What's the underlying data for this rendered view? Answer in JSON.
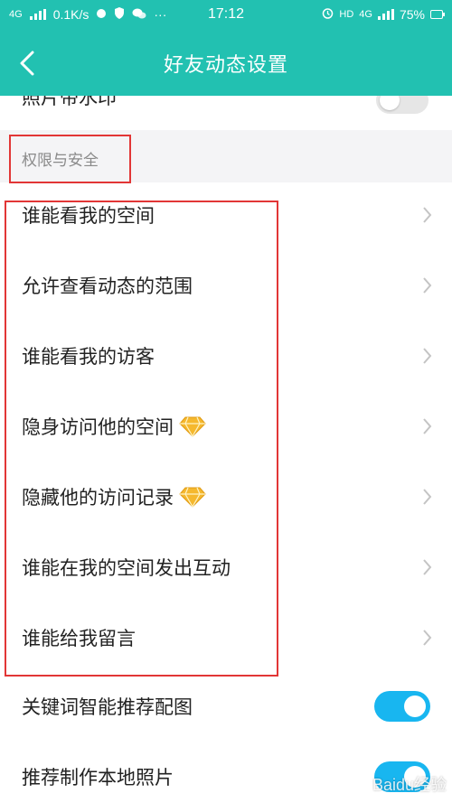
{
  "status_bar": {
    "network": "4G",
    "speed": "0.1K/s",
    "time": "17:12",
    "hd": "HD",
    "network_right": "4G",
    "battery": "75%"
  },
  "header": {
    "title": "好友动态设置",
    "back_icon": "chevron-left-icon"
  },
  "partial_row": {
    "label": "照片带水印",
    "toggle_on": false
  },
  "section": {
    "label": "权限与安全"
  },
  "items": [
    {
      "label": "谁能看我的空间",
      "vip": false
    },
    {
      "label": "允许查看动态的范围",
      "vip": false
    },
    {
      "label": "谁能看我的访客",
      "vip": false
    },
    {
      "label": "隐身访问他的空间",
      "vip": true
    },
    {
      "label": "隐藏他的访问记录",
      "vip": true
    },
    {
      "label": "谁能在我的空间发出互动",
      "vip": false
    },
    {
      "label": "谁能给我留言",
      "vip": false
    }
  ],
  "toggles": [
    {
      "label": "关键词智能推荐配图",
      "on": true
    },
    {
      "label": "推荐制作本地照片",
      "on": true
    }
  ],
  "watermark": "Baidu经验",
  "colors": {
    "brand": "#22c1b1",
    "toggle_on": "#18b6f0",
    "highlight_box": "#e23636",
    "vip_gem": "#f5b82e"
  }
}
